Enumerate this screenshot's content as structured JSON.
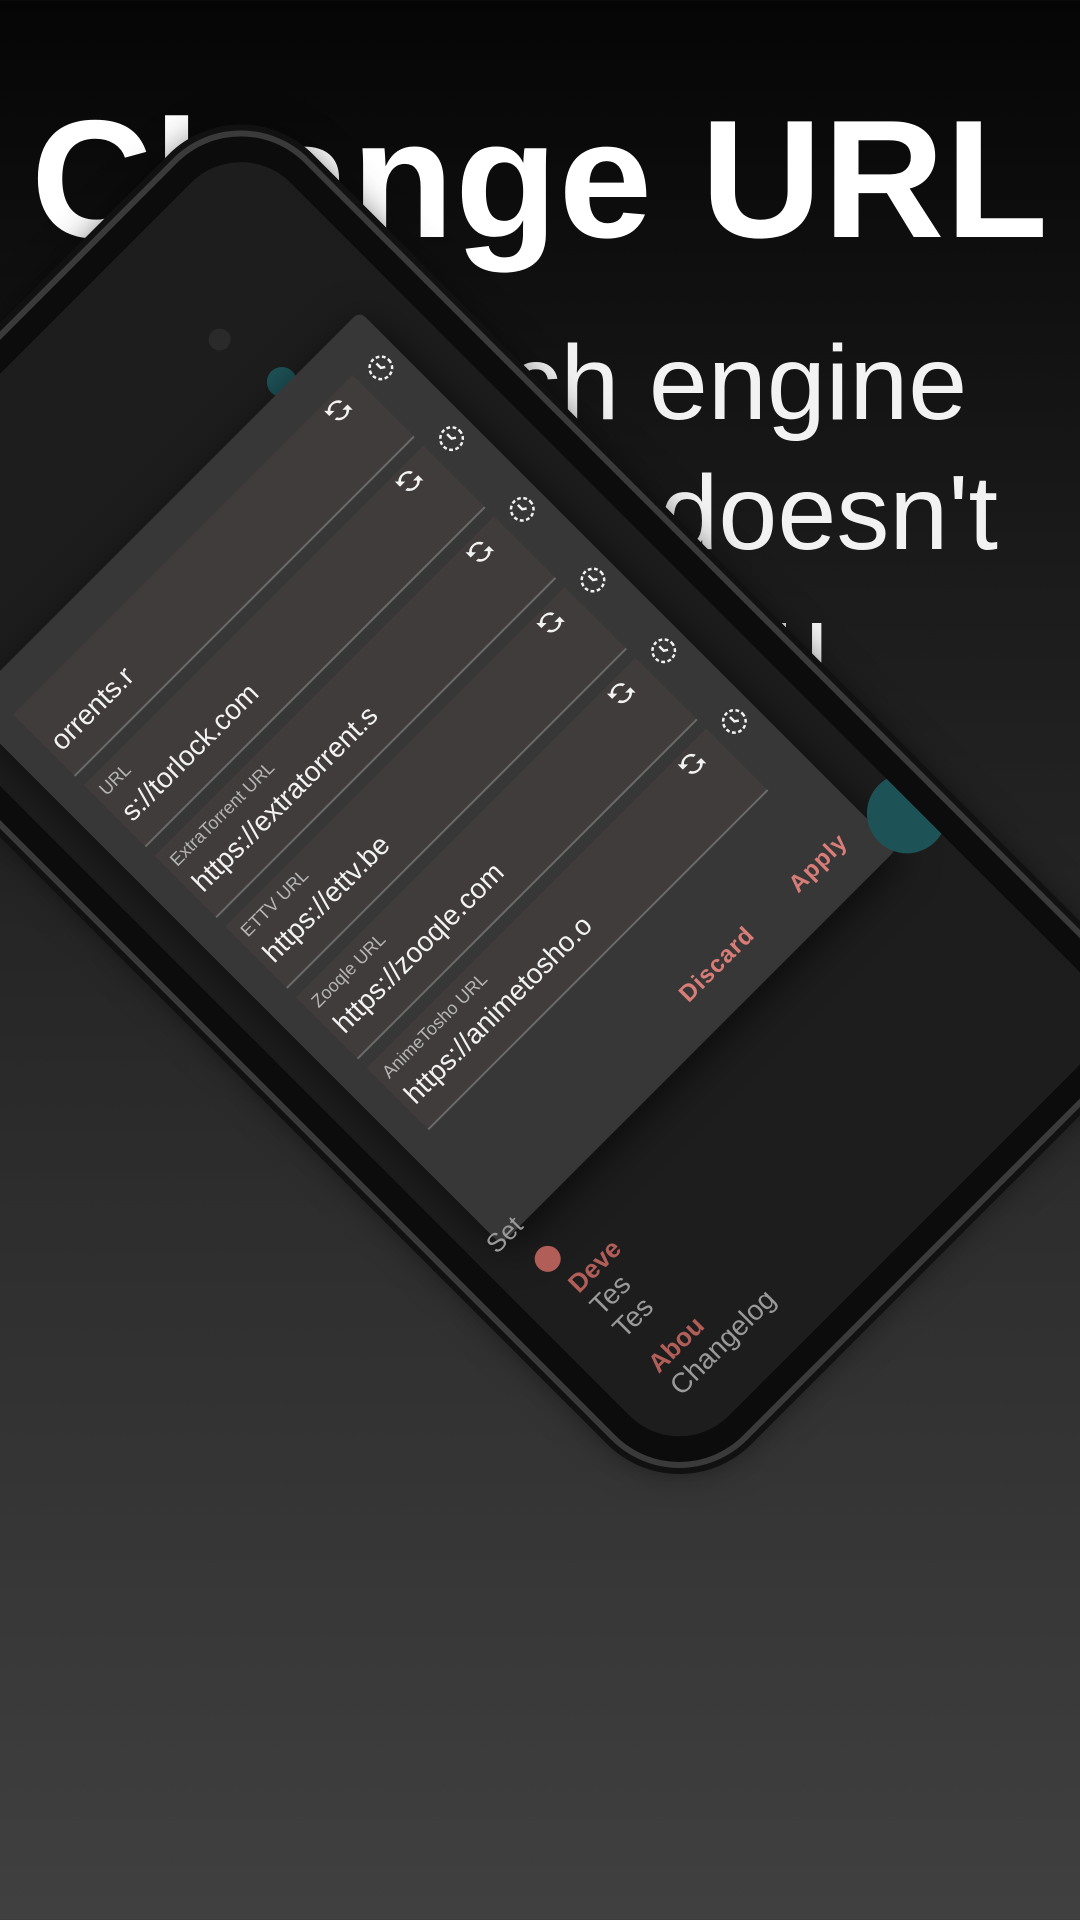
{
  "headline": "Change URL",
  "subline": "Set search engine url if default doesn't work for you",
  "dialog": {
    "items": [
      {
        "label": "",
        "value": "orrents.r"
      },
      {
        "label": "URL",
        "value": "s://torlock.com"
      },
      {
        "label": "ExtraTorrent URL",
        "value": "https://extratorrent.s"
      },
      {
        "label": "ETTV URL",
        "value": "https://ettv.be"
      },
      {
        "label": "Zooqle URL",
        "value": "https://zooqle.com"
      },
      {
        "label": "AnimeTosho URL",
        "value": "https://animetosho.o"
      }
    ],
    "discard_label": "Discard",
    "apply_label": "Apply"
  },
  "background": {
    "settings_fragment": "Set",
    "dev_label": "Deve",
    "test_a": "Tes",
    "test_b": "Tes",
    "about_label": "Abou",
    "changelog_label": "Changelog"
  },
  "colors": {
    "accent": "#d97d78",
    "fab": "#1d5257"
  }
}
